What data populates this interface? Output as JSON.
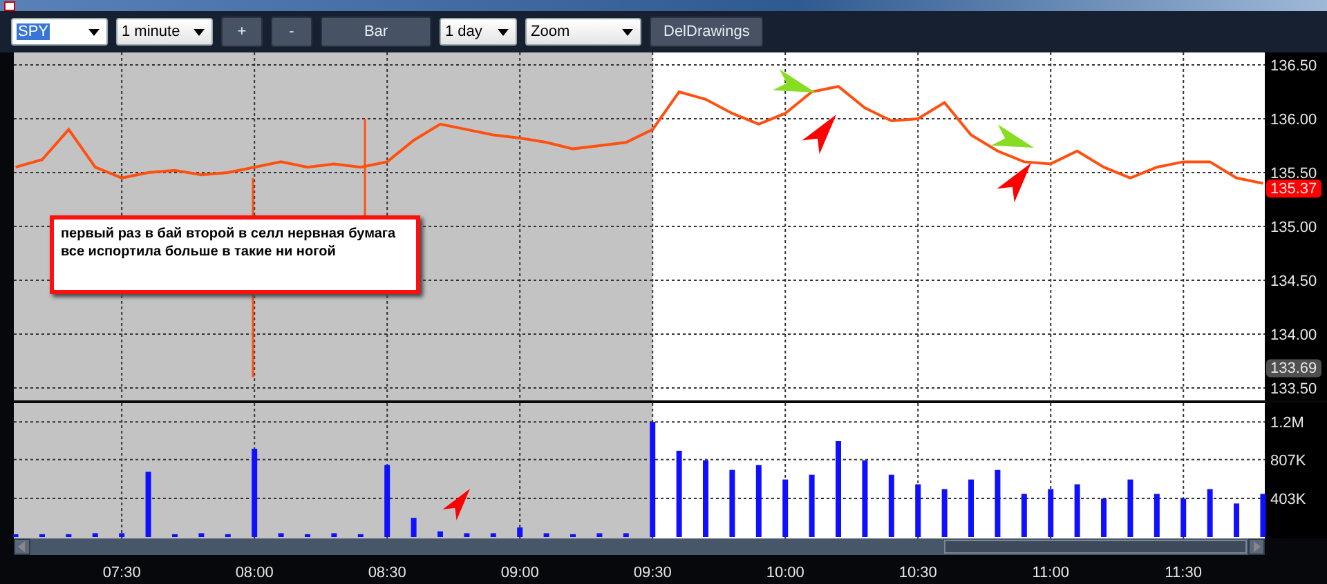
{
  "toolbar": {
    "symbol": {
      "value": "SPY"
    },
    "interval": {
      "value": "1 minute"
    },
    "zoom_in": {
      "label": "+"
    },
    "zoom_out": {
      "label": "-"
    },
    "chart_style": {
      "label": "Bar"
    },
    "range": {
      "value": "1 day"
    },
    "mode": {
      "value": "Zoom"
    },
    "clear": {
      "label": "DelDrawings"
    }
  },
  "price_chart": {
    "chart_data": {
      "type": "line",
      "x": [
        426,
        432,
        438,
        444,
        450,
        456,
        462,
        468,
        474,
        480,
        486,
        492,
        498,
        504,
        510,
        516,
        522,
        528,
        534,
        540,
        546,
        552,
        558,
        564,
        570,
        576,
        582,
        588,
        594,
        600,
        606,
        612,
        618,
        624,
        630,
        636,
        642,
        648,
        654,
        660,
        666,
        672,
        678,
        684,
        690,
        696,
        702,
        708
      ],
      "series": [
        {
          "color": "#ff5010",
          "values": [
            135.55,
            135.62,
            135.9,
            135.55,
            135.45,
            135.5,
            135.52,
            135.48,
            135.5,
            135.55,
            135.6,
            135.55,
            135.58,
            135.55,
            135.6,
            135.8,
            135.95,
            135.9,
            135.85,
            135.82,
            135.78,
            135.72,
            135.75,
            135.78,
            135.9,
            136.25,
            136.18,
            136.05,
            135.95,
            136.05,
            136.25,
            136.3,
            136.1,
            135.98,
            136.0,
            136.15,
            135.85,
            135.7,
            135.6,
            135.58,
            135.7,
            135.55,
            135.45,
            135.55,
            135.6,
            135.6,
            135.45,
            135.4
          ]
        }
      ],
      "xlim": [
        425.6,
        708.4
      ],
      "ylim": [
        133.385,
        136.615
      ],
      "grid": true,
      "yticks": [
        {
          "value": 133.5,
          "label": "133.50"
        },
        {
          "value": 134,
          "label": "134.00"
        },
        {
          "value": 134.5,
          "label": "134.50"
        },
        {
          "value": 135,
          "label": "135.00"
        },
        {
          "value": 135.5,
          "label": "135.50"
        },
        {
          "value": 136,
          "label": "136.00"
        },
        {
          "value": 136.5,
          "label": "136.50"
        }
      ]
    },
    "last_price_tag": {
      "label": "135.37"
    },
    "low_price_tag": {
      "label": "133.69"
    },
    "drawings": [
      {
        "kind": "arrow",
        "color": "#88dd22"
      },
      {
        "kind": "arrow",
        "color": "#ff0000"
      },
      {
        "kind": "arrow",
        "color": "#88dd22"
      },
      {
        "kind": "arrow",
        "color": "#ff0000"
      }
    ],
    "note": {
      "text": "первый раз в бай второй в селл нервная бумага все испортила больше в такие ни ногой"
    }
  },
  "volume_chart": {
    "chart_data": {
      "type": "bar",
      "x": [
        426,
        432,
        438,
        444,
        450,
        456,
        462,
        468,
        474,
        480,
        486,
        492,
        498,
        504,
        510,
        516,
        522,
        528,
        534,
        540,
        546,
        552,
        558,
        564,
        570,
        576,
        582,
        588,
        594,
        600,
        606,
        612,
        618,
        624,
        630,
        636,
        642,
        648,
        654,
        660,
        666,
        672,
        678,
        684,
        690,
        696,
        702,
        708
      ],
      "series": [
        {
          "color": "#1010ff",
          "values": [
            30000,
            30000,
            30000,
            40000,
            40000,
            680000,
            30000,
            40000,
            30000,
            920000,
            40000,
            30000,
            40000,
            30000,
            750000,
            200000,
            60000,
            40000,
            40000,
            100000,
            40000,
            30000,
            40000,
            40000,
            1200000,
            900000,
            800000,
            700000,
            750000,
            600000,
            650000,
            1000000,
            800000,
            650000,
            550000,
            500000,
            600000,
            700000,
            450000,
            500000,
            550000,
            400000,
            600000,
            450000,
            400000,
            500000,
            350000,
            450000
          ]
        }
      ],
      "xlim": [
        425.6,
        708.4
      ],
      "ylim": [
        0,
        1396000
      ],
      "grid": true,
      "xticks": [
        {
          "value": 450,
          "label": "07:30"
        },
        {
          "value": 480,
          "label": "08:00"
        },
        {
          "value": 510,
          "label": "08:30"
        },
        {
          "value": 540,
          "label": "09:00"
        },
        {
          "value": 570,
          "label": "09:30"
        },
        {
          "value": 600,
          "label": "10:00"
        },
        {
          "value": 630,
          "label": "10:30"
        },
        {
          "value": 660,
          "label": "11:00"
        },
        {
          "value": 690,
          "label": "11:30"
        }
      ],
      "yticks": [
        {
          "value": 403000,
          "label": "403K"
        },
        {
          "value": 807000,
          "label": "807K"
        },
        {
          "value": 1200000,
          "label": "1.2M"
        }
      ]
    },
    "drawings": [
      {
        "kind": "arrow",
        "color": "#ff0000"
      }
    ]
  }
}
